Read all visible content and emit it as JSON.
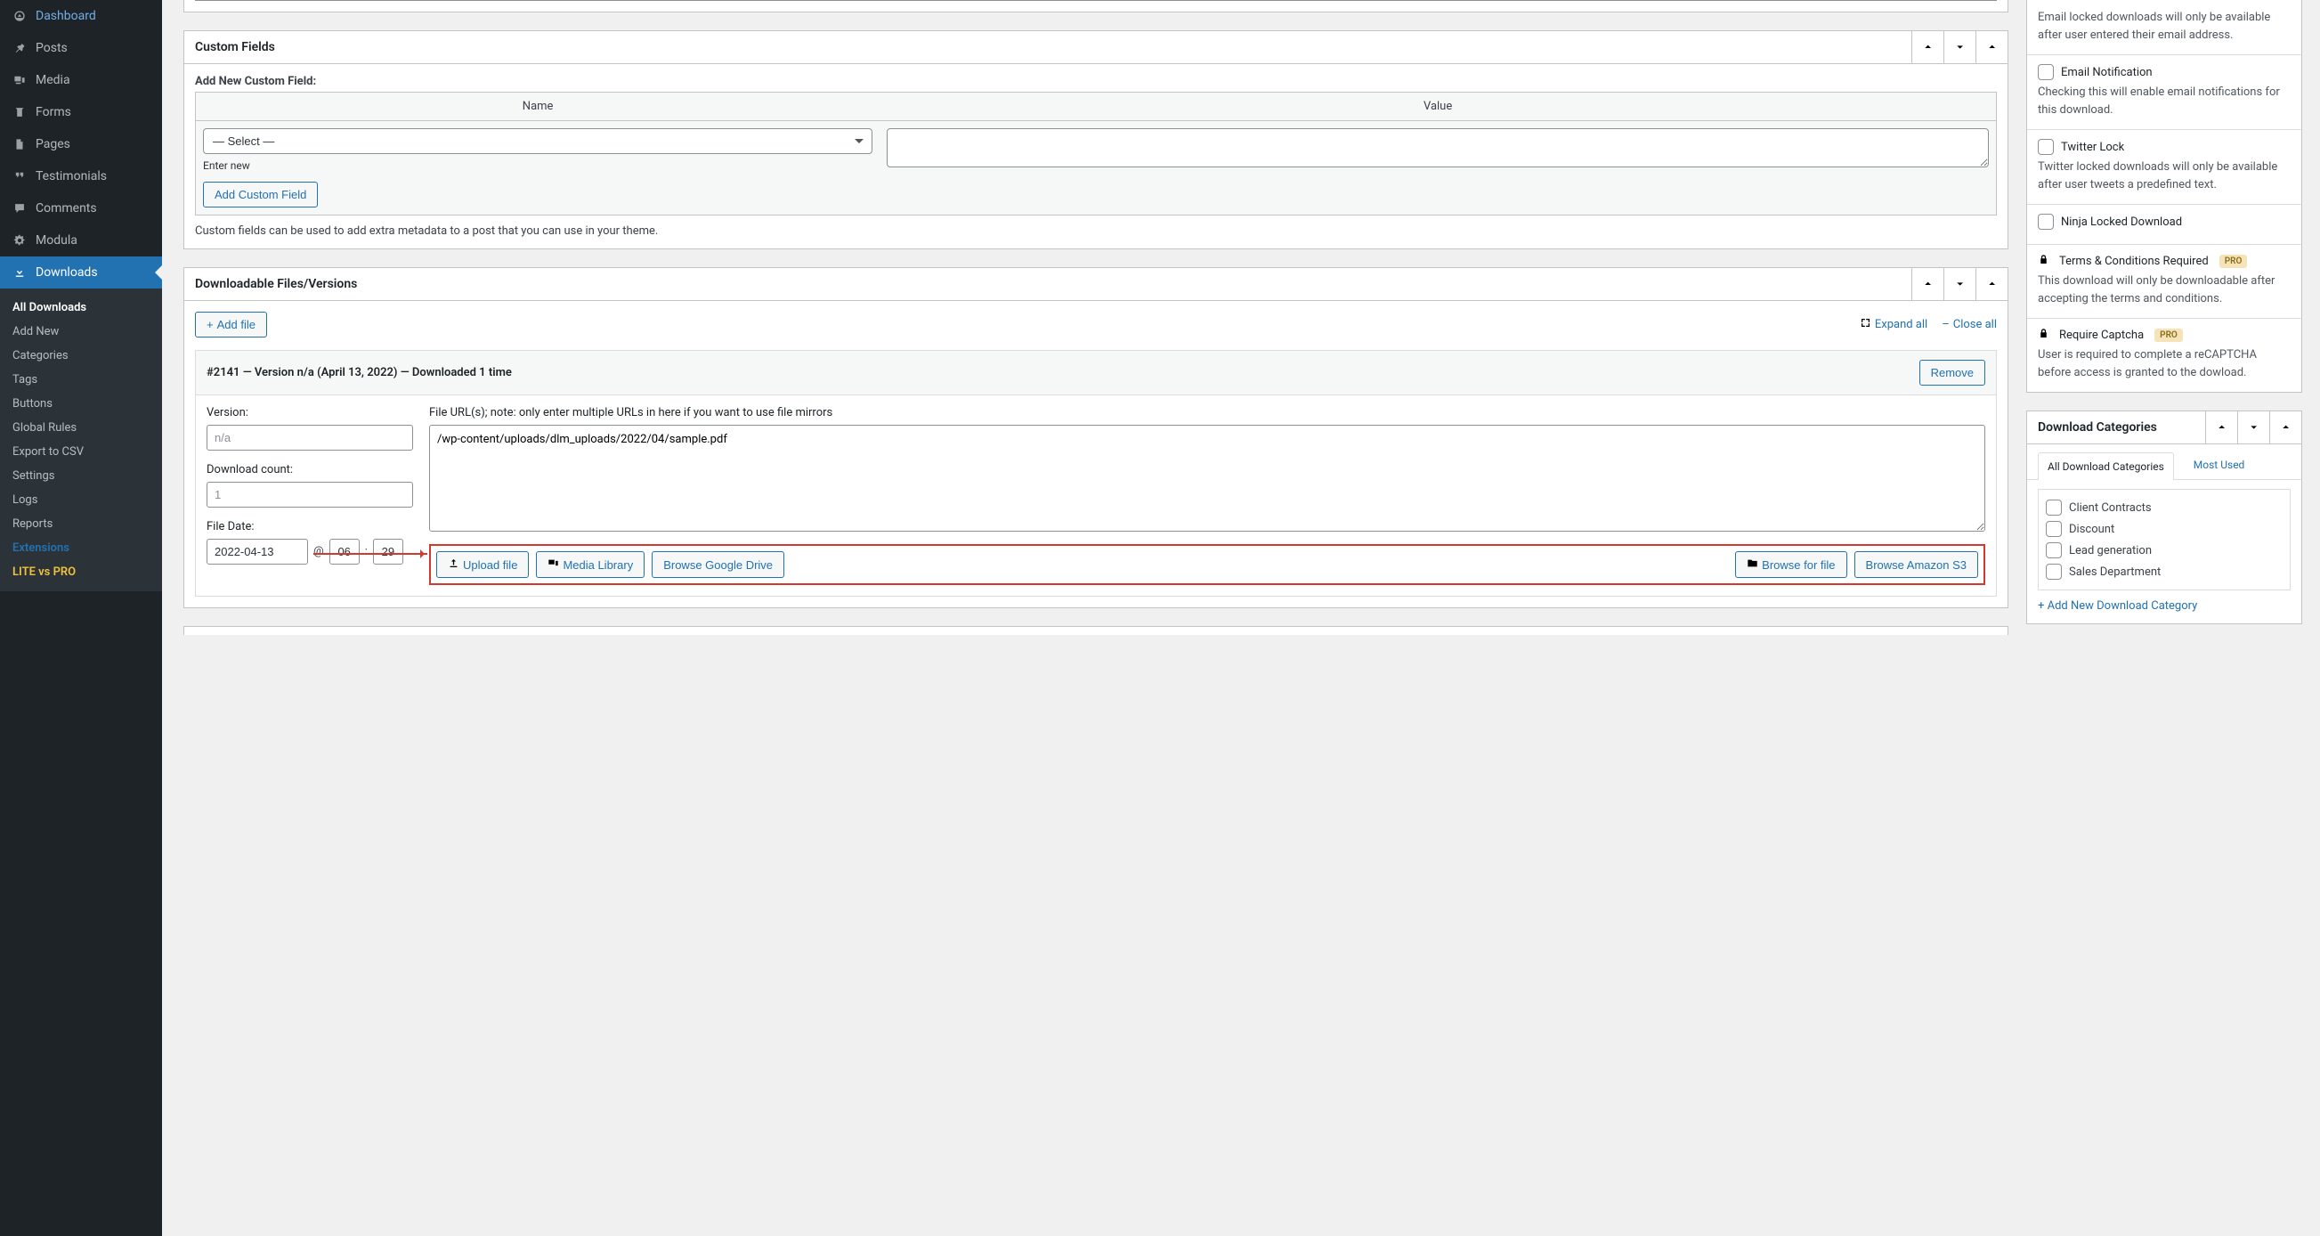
{
  "sidebar": {
    "items": [
      {
        "label": "Dashboard"
      },
      {
        "label": "Posts"
      },
      {
        "label": "Media"
      },
      {
        "label": "Forms"
      },
      {
        "label": "Pages"
      },
      {
        "label": "Testimonials"
      },
      {
        "label": "Comments"
      },
      {
        "label": "Modula"
      },
      {
        "label": "Downloads"
      }
    ],
    "submenu": [
      {
        "label": "All Downloads",
        "current": true
      },
      {
        "label": "Add New"
      },
      {
        "label": "Categories"
      },
      {
        "label": "Tags"
      },
      {
        "label": "Buttons"
      },
      {
        "label": "Global Rules"
      },
      {
        "label": "Export to CSV"
      },
      {
        "label": "Settings"
      },
      {
        "label": "Logs"
      },
      {
        "label": "Reports"
      },
      {
        "label": "Extensions",
        "ext": true
      },
      {
        "label": "LITE vs PRO",
        "lite": true
      }
    ]
  },
  "custom_fields": {
    "box_title": "Custom Fields",
    "add_label": "Add New Custom Field:",
    "name_header": "Name",
    "value_header": "Value",
    "select_placeholder": "— Select —",
    "enter_new": "Enter new",
    "add_button": "Add Custom Field",
    "note": "Custom fields can be used to add extra metadata to a post that you can use in your theme."
  },
  "files_box": {
    "title": "Downloadable Files/Versions",
    "add_file": "Add file",
    "expand_all": "Expand all",
    "close_all": "Close all",
    "file_header": "#2141 — Version n/a (April 13, 2022) — Downloaded 1 time",
    "remove": "Remove",
    "version_label": "Version:",
    "version_placeholder": "n/a",
    "download_count_label": "Download count:",
    "download_count_placeholder": "1",
    "file_date_label": "File Date:",
    "date_value": "2022-04-13",
    "at": "@",
    "hour": "06",
    "colon": ":",
    "minute": "29",
    "url_label": "File URL(s); note: only enter multiple URLs in here if you want to use file mirrors",
    "url_value": "/wp-content/uploads/dlm_uploads/2022/04/sample.pdf",
    "upload_file": "Upload file",
    "media_library": "Media Library",
    "browse_gdrive": "Browse Google Drive",
    "browse_for_file": "Browse for file",
    "browse_s3": "Browse Amazon S3"
  },
  "side_options": {
    "email_lock_desc": "Email locked downloads will only be available after user entered their email address.",
    "email_notif_title": "Email Notification",
    "email_notif_desc": "Checking this will enable email notifications for this download.",
    "twitter_title": "Twitter Lock",
    "twitter_desc": "Twitter locked downloads will only be available after user tweets a predefined text.",
    "ninja_title": "Ninja Locked Download",
    "terms_title": "Terms & Conditions Required",
    "terms_desc": "This download will only be downloadable after accepting the terms and conditions.",
    "captcha_title": "Require Captcha",
    "captcha_desc": "User is required to complete a reCAPTCHA before access is granted to the dowload.",
    "pro": "PRO"
  },
  "categories_box": {
    "title": "Download Categories",
    "tab_all": "All Download Categories",
    "tab_most": "Most Used",
    "items": [
      "Client Contracts",
      "Discount",
      "Lead generation",
      "Sales Department"
    ],
    "add_new": "+ Add New Download Category"
  }
}
